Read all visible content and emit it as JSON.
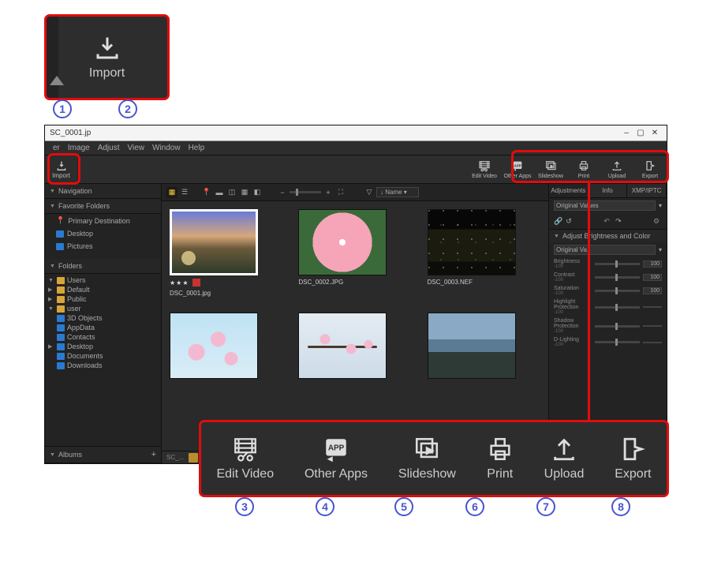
{
  "zoom_import": {
    "label": "Import"
  },
  "window": {
    "title_file": "SC_0001.jp",
    "ctrl_min": "–",
    "ctrl_max": "▢",
    "ctrl_close": "✕"
  },
  "menu": {
    "items": [
      "er",
      "Image",
      "Adjust",
      "View",
      "Window",
      "Help"
    ]
  },
  "toolbar": {
    "import": "Import",
    "out": [
      {
        "key": "edit-video",
        "label": "Edit Video"
      },
      {
        "key": "other-apps",
        "label": "Other Apps"
      },
      {
        "key": "slideshow",
        "label": "Slideshow"
      },
      {
        "key": "print",
        "label": "Print"
      },
      {
        "key": "upload",
        "label": "Upload"
      },
      {
        "key": "export",
        "label": "Export"
      }
    ]
  },
  "left": {
    "nav": "Navigation",
    "fav": "Favorite Folders",
    "primary": "Primary Destination",
    "desktop": "Desktop",
    "pictures": "Pictures",
    "folders": "Folders",
    "tree": [
      {
        "ind": 1,
        "exp": "▼",
        "color": "y",
        "name": "Users"
      },
      {
        "ind": 2,
        "exp": "▶",
        "color": "y",
        "name": "Default"
      },
      {
        "ind": 2,
        "exp": "▶",
        "color": "y",
        "name": "Public"
      },
      {
        "ind": 2,
        "exp": "▼",
        "color": "y",
        "name": "user"
      },
      {
        "ind": 3,
        "exp": "",
        "color": "b",
        "name": "3D Objects"
      },
      {
        "ind": 3,
        "exp": "",
        "color": "b",
        "name": "AppData"
      },
      {
        "ind": 3,
        "exp": "",
        "color": "b",
        "name": "Contacts"
      },
      {
        "ind": 3,
        "exp": "▶",
        "color": "b",
        "name": "Desktop"
      },
      {
        "ind": 3,
        "exp": "",
        "color": "b",
        "name": "Documents"
      },
      {
        "ind": 3,
        "exp": "",
        "color": "b",
        "name": "Downloads"
      }
    ],
    "albums": "Albums"
  },
  "viewbar": {
    "sort_label": "Name"
  },
  "thumbs": [
    {
      "file": "DSC_0001.jpg",
      "stars": "★★★",
      "badge": true,
      "sel": true,
      "imgcls": "img-sunset"
    },
    {
      "file": "DSC_0002.JPG",
      "imgcls": "img-flower"
    },
    {
      "file": "DSC_0003.NEF",
      "imgcls": "img-night"
    },
    {
      "file": "",
      "imgcls": "img-blossom"
    },
    {
      "file": "",
      "imgcls": "img-branch"
    },
    {
      "file": "",
      "imgcls": "img-shore"
    }
  ],
  "right": {
    "tabs": [
      "Adjustments",
      "Info",
      "XMP/IPTC"
    ],
    "preset": "Original Values",
    "group": "Adjust Brightness and Color",
    "subpreset": "Original Va",
    "sliders": [
      {
        "name": "Brightness",
        "val": "100"
      },
      {
        "name": "Contrast",
        "val": "100"
      },
      {
        "name": "Saturation",
        "val": "100"
      },
      {
        "name": "Highlight Protection",
        "val": ""
      },
      {
        "name": "Shadow Protection",
        "val": ""
      },
      {
        "name": "D-Lighting",
        "val": ""
      }
    ]
  },
  "callouts": {
    "n1": "1",
    "n2": "2",
    "n3": "3",
    "n4": "4",
    "n5": "5",
    "n6": "6",
    "n7": "7",
    "n8": "8"
  }
}
